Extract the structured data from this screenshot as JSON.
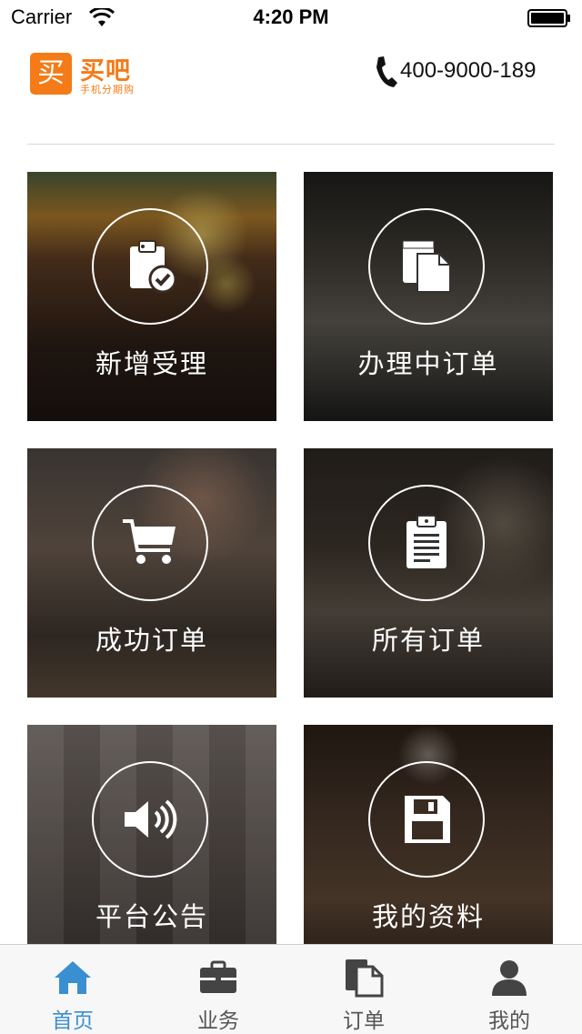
{
  "status_bar": {
    "carrier": "Carrier",
    "time": "4:20 PM"
  },
  "header": {
    "logo_glyph": "买",
    "logo_title": "买吧",
    "logo_subtitle": "手机分期购",
    "phone_number": "400-9000-189"
  },
  "tiles": [
    {
      "label": "新增受理",
      "icon": "clipboard-check-icon"
    },
    {
      "label": "办理中订单",
      "icon": "documents-icon"
    },
    {
      "label": "成功订单",
      "icon": "cart-icon"
    },
    {
      "label": "所有订单",
      "icon": "clipboard-list-icon"
    },
    {
      "label": "平台公告",
      "icon": "speaker-icon"
    },
    {
      "label": "我的资料",
      "icon": "floppy-disk-icon"
    }
  ],
  "tabbar": {
    "items": [
      {
        "label": "首页",
        "icon": "home-icon",
        "active": true
      },
      {
        "label": "业务",
        "icon": "briefcase-icon",
        "active": false
      },
      {
        "label": "订单",
        "icon": "document-icon",
        "active": false
      },
      {
        "label": "我的",
        "icon": "user-icon",
        "active": false
      }
    ],
    "active_color": "#3a8fd0",
    "inactive_color": "#555555"
  },
  "colors": {
    "brand": "#f47b17"
  }
}
